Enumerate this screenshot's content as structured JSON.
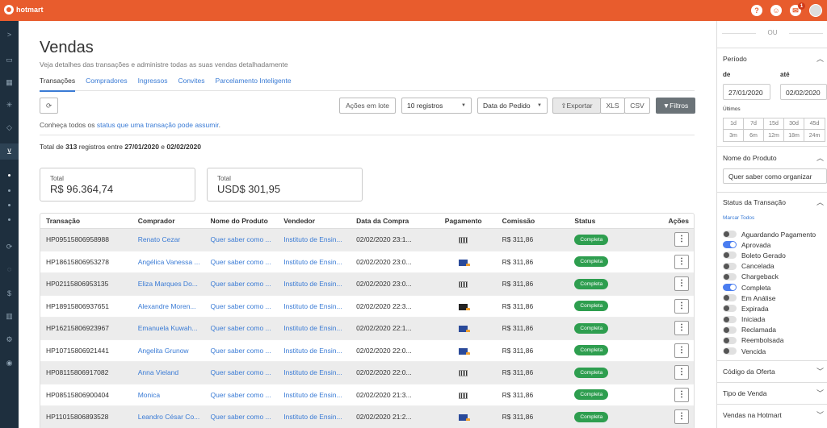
{
  "topbar": {
    "logo": "hotmart",
    "notification_count": "1"
  },
  "nav": {
    "chevron": ">",
    "chevron_icon": "chevron-right-icon",
    "icons": [
      "dashboard-icon",
      "grid-icon",
      "network-icon",
      "box-icon",
      "cart-icon",
      "refresh-icon",
      "chat-icon",
      "dollar-icon",
      "chart-icon",
      "gear-icon",
      "user-icon"
    ]
  },
  "page": {
    "title": "Vendas",
    "subtitle": "Veja detalhes das transações e administre todas as suas vendas detalhadamente",
    "tabs": [
      "Transações",
      "Compradores",
      "Ingressos",
      "Convites",
      "Parcelamento Inteligente"
    ]
  },
  "toolbar": {
    "batch": "Ações em lote",
    "registros": "10 registros",
    "order": "Data do Pedido",
    "export": "Exportar",
    "xls": "XLS",
    "csv": "CSV",
    "filters": "Filtros"
  },
  "info": {
    "prefix": "Conheça todos os ",
    "link": "status que uma transação pode assumir",
    "suffix": "."
  },
  "total": {
    "t1": "Total de ",
    "count": "313",
    "t2": " registros entre ",
    "from": "27/01/2020",
    "t3": " e ",
    "to": "02/02/2020"
  },
  "cards": [
    {
      "label": "Total",
      "value": "R$ 96.364,74"
    },
    {
      "label": "Total",
      "value": "USD$ 301,95"
    }
  ],
  "table": {
    "headers": [
      "Transação",
      "Comprador",
      "Nome do Produto",
      "Vendedor",
      "Data da Compra",
      "Pagamento",
      "Comissão",
      "Status",
      "Ações"
    ],
    "rows": [
      {
        "id": "HP09515806958988",
        "buyer": "Renato Cezar",
        "product": "Quer saber como ...",
        "seller": "Instituto de Ensin...",
        "date": "02/02/2020 23:1...",
        "pay": "barcode",
        "commission": "R$ 311,86",
        "status": "Completa"
      },
      {
        "id": "HP18615806953278",
        "buyer": "Angélica Vanessa ...",
        "product": "Quer saber como ...",
        "seller": "Instituto de Ensin...",
        "date": "02/02/2020 23:0...",
        "pay": "blue",
        "commission": "R$ 311,86",
        "status": "Completa"
      },
      {
        "id": "HP02115806953135",
        "buyer": "Eliza Marques Do...",
        "product": "Quer saber como ...",
        "seller": "Instituto de Ensin...",
        "date": "02/02/2020 23:0...",
        "pay": "barcode",
        "commission": "R$ 311,86",
        "status": "Completa"
      },
      {
        "id": "HP18915806937651",
        "buyer": "Alexandre Moren...",
        "product": "Quer saber como ...",
        "seller": "Instituto de Ensin...",
        "date": "02/02/2020 22:3...",
        "pay": "dark",
        "commission": "R$ 311,86",
        "status": "Completa"
      },
      {
        "id": "HP16215806923967",
        "buyer": "Emanuela Kuwah...",
        "product": "Quer saber como ...",
        "seller": "Instituto de Ensin...",
        "date": "02/02/2020 22:1...",
        "pay": "blue",
        "commission": "R$ 311,86",
        "status": "Completa"
      },
      {
        "id": "HP10715806921441",
        "buyer": "Angelita Grunow",
        "product": "Quer saber como ...",
        "seller": "Instituto de Ensin...",
        "date": "02/02/2020 22:0...",
        "pay": "blue",
        "commission": "R$ 311,86",
        "status": "Completa"
      },
      {
        "id": "HP08115806917082",
        "buyer": "Anna Vieland",
        "product": "Quer saber como ...",
        "seller": "Instituto de Ensin...",
        "date": "02/02/2020 22:0...",
        "pay": "barcode",
        "commission": "R$ 311,86",
        "status": "Completa"
      },
      {
        "id": "HP08515806900404",
        "buyer": "Monica",
        "product": "Quer saber como ...",
        "seller": "Instituto de Ensin...",
        "date": "02/02/2020 21:3...",
        "pay": "barcode",
        "commission": "R$ 311,86",
        "status": "Completa"
      },
      {
        "id": "HP11015806893528",
        "buyer": "Leandro César Co...",
        "product": "Quer saber como ...",
        "seller": "Instituto de Ensin...",
        "date": "02/02/2020 21:2...",
        "pay": "blue",
        "commission": "R$ 311,86",
        "status": "Completa"
      }
    ]
  },
  "filters": {
    "ou": "OU",
    "periodo": "Período",
    "de_label": "de",
    "ate_label": "até",
    "de": "27/01/2020",
    "ate": "02/02/2020",
    "ultimos": "Últimos",
    "quick": [
      "1d",
      "7d",
      "15d",
      "30d",
      "45d",
      "3m",
      "6m",
      "12m",
      "18m",
      "24m"
    ],
    "produto_title": "Nome do Produto",
    "produto_value": "Quer saber como organizar",
    "status_title": "Status da Transação",
    "marcar": "Marcar Todos",
    "statuses": [
      {
        "label": "Aguardando Pagamento",
        "on": false
      },
      {
        "label": "Aprovada",
        "on": true
      },
      {
        "label": "Boleto Gerado",
        "on": false
      },
      {
        "label": "Cancelada",
        "on": false
      },
      {
        "label": "Chargeback",
        "on": false
      },
      {
        "label": "Completa",
        "on": true
      },
      {
        "label": "Em Análise",
        "on": false
      },
      {
        "label": "Expirada",
        "on": false
      },
      {
        "label": "Iniciada",
        "on": false
      },
      {
        "label": "Reclamada",
        "on": false
      },
      {
        "label": "Reembolsada",
        "on": false
      },
      {
        "label": "Vencida",
        "on": false
      }
    ],
    "codigo": "Código da Oferta",
    "tipo": "Tipo de Venda",
    "vendas_hotmart": "Vendas na Hotmart"
  },
  "colors": {
    "topbar": "#e85c2d",
    "nav": "#1e2f3e",
    "status_ok": "#2e9e4f",
    "link": "#3a7bd5",
    "toggle_on": "#4a7df0"
  }
}
